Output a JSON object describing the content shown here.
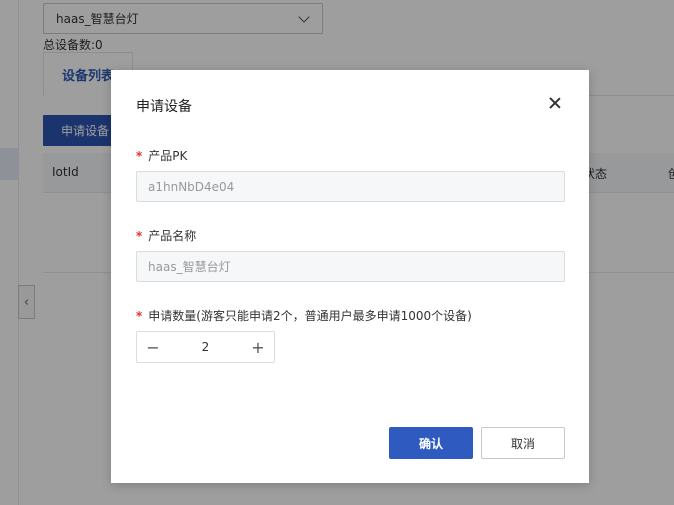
{
  "background": {
    "product_select_value": "haas_智慧台灯",
    "total_device_count": "总设备数:0",
    "tab_device_list": "设备列表",
    "apply_button_label": "申请设备",
    "table_headers": {
      "iotid": "IotId",
      "status": "状态",
      "create": "创"
    },
    "collapse_icon": "chevron-left"
  },
  "modal": {
    "title": "申请设备",
    "required_mark": "*",
    "fields": {
      "product_pk": {
        "label": "产品PK",
        "value": "a1hnNbD4e04"
      },
      "product_name": {
        "label": "产品名称",
        "value": "haas_智慧台灯"
      },
      "quantity": {
        "label": "申请数量(游客只能申请2个，普通用户最多申请1000个设备)",
        "value": "2",
        "minus": "−",
        "plus": "+"
      }
    },
    "confirm_label": "确认",
    "cancel_label": "取消"
  },
  "colors": {
    "primary": "#2f5bc1",
    "required": "#d9342b",
    "overlay": "rgba(0,0,0,0.38)"
  }
}
